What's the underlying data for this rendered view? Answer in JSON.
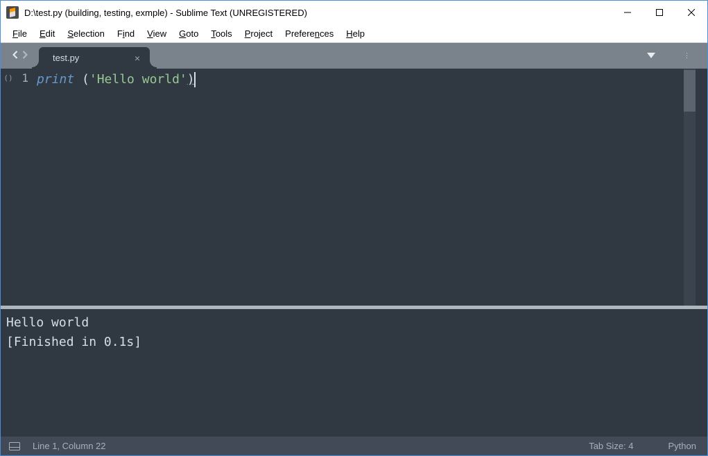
{
  "window": {
    "title": "D:\\test.py (building, testing, exmple) - Sublime Text (UNREGISTERED)"
  },
  "menu": [
    {
      "label": "File",
      "accel": "F"
    },
    {
      "label": "Edit",
      "accel": "E"
    },
    {
      "label": "Selection",
      "accel": "S"
    },
    {
      "label": "Find",
      "accel": "i"
    },
    {
      "label": "View",
      "accel": "V"
    },
    {
      "label": "Goto",
      "accel": "G"
    },
    {
      "label": "Tools",
      "accel": "T"
    },
    {
      "label": "Project",
      "accel": "P"
    },
    {
      "label": "Preferences",
      "accel": "n"
    },
    {
      "label": "Help",
      "accel": "H"
    }
  ],
  "tabs": {
    "active": {
      "label": "test.py"
    }
  },
  "editor": {
    "gutter_fold": "()",
    "line_number": "1",
    "code": {
      "func": "print",
      "space": " ",
      "open": "(",
      "str": "'Hello world'",
      "close": ")"
    }
  },
  "output": {
    "line1": "Hello world",
    "line2": "[Finished in 0.1s]"
  },
  "status": {
    "position": "Line 1, Column 22",
    "tabsize": "Tab Size: 4",
    "syntax": "Python"
  }
}
